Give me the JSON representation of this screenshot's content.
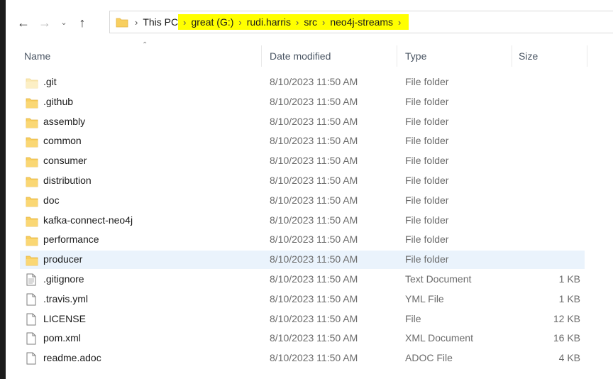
{
  "address_bar": {
    "breadcrumbs": [
      {
        "label": "This PC",
        "highlighted": false
      },
      {
        "label": "great (G:)",
        "highlighted": true
      },
      {
        "label": "rudi.harris",
        "highlighted": true
      },
      {
        "label": "src",
        "highlighted": true
      },
      {
        "label": "neo4j-streams",
        "highlighted": true
      }
    ]
  },
  "columns": {
    "name": "Name",
    "date_modified": "Date modified",
    "type": "Type",
    "size": "Size"
  },
  "files": [
    {
      "name": ".git",
      "date": "8/10/2023 11:50 AM",
      "type": "File folder",
      "size": "",
      "kind": "folder-faded"
    },
    {
      "name": ".github",
      "date": "8/10/2023 11:50 AM",
      "type": "File folder",
      "size": "",
      "kind": "folder"
    },
    {
      "name": "assembly",
      "date": "8/10/2023 11:50 AM",
      "type": "File folder",
      "size": "",
      "kind": "folder"
    },
    {
      "name": "common",
      "date": "8/10/2023 11:50 AM",
      "type": "File folder",
      "size": "",
      "kind": "folder"
    },
    {
      "name": "consumer",
      "date": "8/10/2023 11:50 AM",
      "type": "File folder",
      "size": "",
      "kind": "folder"
    },
    {
      "name": "distribution",
      "date": "8/10/2023 11:50 AM",
      "type": "File folder",
      "size": "",
      "kind": "folder"
    },
    {
      "name": "doc",
      "date": "8/10/2023 11:50 AM",
      "type": "File folder",
      "size": "",
      "kind": "folder"
    },
    {
      "name": "kafka-connect-neo4j",
      "date": "8/10/2023 11:50 AM",
      "type": "File folder",
      "size": "",
      "kind": "folder"
    },
    {
      "name": "performance",
      "date": "8/10/2023 11:50 AM",
      "type": "File folder",
      "size": "",
      "kind": "folder"
    },
    {
      "name": "producer",
      "date": "8/10/2023 11:50 AM",
      "type": "File folder",
      "size": "",
      "kind": "folder",
      "selected": true
    },
    {
      "name": ".gitignore",
      "date": "8/10/2023 11:50 AM",
      "type": "Text Document",
      "size": "1 KB",
      "kind": "text"
    },
    {
      "name": ".travis.yml",
      "date": "8/10/2023 11:50 AM",
      "type": "YML File",
      "size": "1 KB",
      "kind": "file"
    },
    {
      "name": "LICENSE",
      "date": "8/10/2023 11:50 AM",
      "type": "File",
      "size": "12 KB",
      "kind": "file"
    },
    {
      "name": "pom.xml",
      "date": "8/10/2023 11:50 AM",
      "type": "XML Document",
      "size": "16 KB",
      "kind": "file"
    },
    {
      "name": "readme.adoc",
      "date": "8/10/2023 11:50 AM",
      "type": "ADOC File",
      "size": "4 KB",
      "kind": "file"
    }
  ],
  "colors": {
    "highlight": "#ffff00",
    "folder": "#f8cf5f",
    "folder_dark": "#e3b341",
    "selected_row": "#eaf3fc"
  }
}
